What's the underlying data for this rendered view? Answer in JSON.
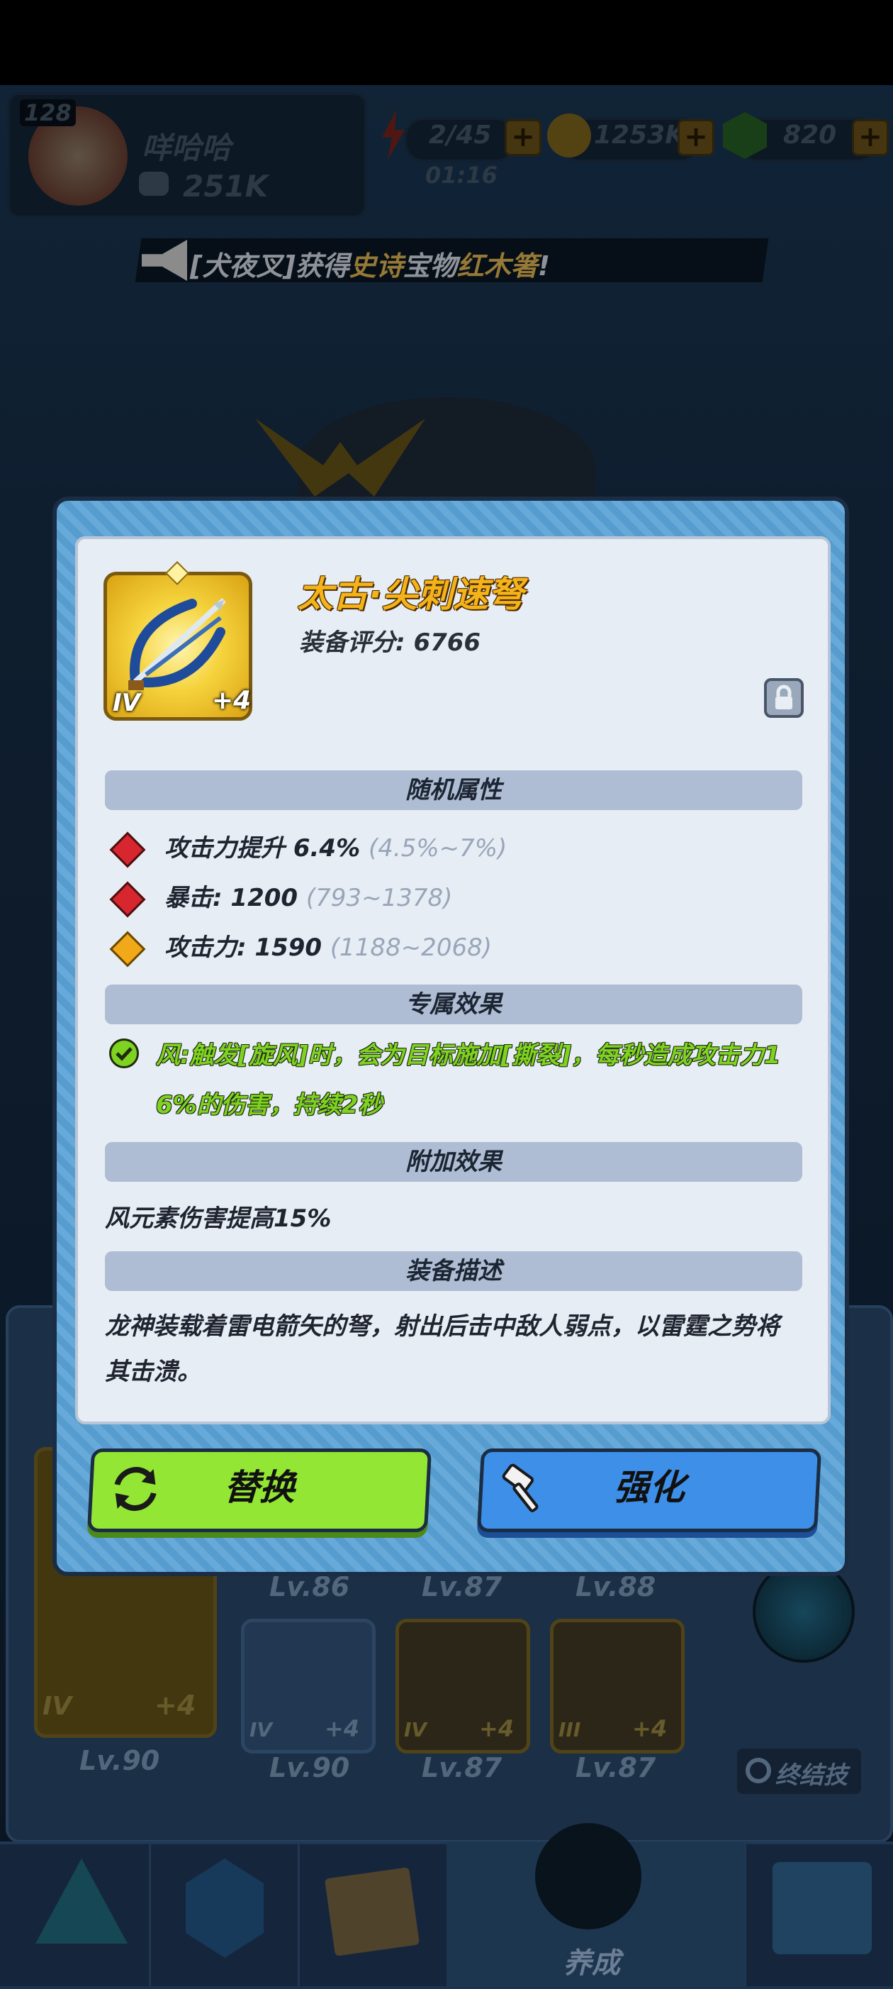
{
  "hud": {
    "level": "128",
    "player_name": "咩哈哈",
    "power": "251K",
    "energy": "2/45",
    "timer": "01:16",
    "gold": "1253K",
    "gems": "820"
  },
  "announcement": {
    "prefix": "[犬夜叉]获得",
    "rarity": "史诗",
    "middle": "宝物",
    "item": "红木箸",
    "suffix": "!"
  },
  "background": {
    "equip_levels_row1": [
      "Lv.86",
      "Lv.87",
      "Lv.88"
    ],
    "equip_levels_row2": [
      "Lv.90",
      "Lv.87",
      "Lv.87"
    ],
    "big_equip": {
      "level": "Lv.90",
      "tier": "IV",
      "plus": "+4"
    },
    "small_equips": [
      {
        "tier": "IV",
        "plus": "+4"
      },
      {
        "tier": "IV",
        "plus": "+4"
      },
      {
        "tier": "III",
        "plus": "+4"
      }
    ],
    "ultimate_label": "终结技",
    "nav_active_label": "养成"
  },
  "item": {
    "name": "太古·尖刺速弩",
    "score_label": "装备评分:",
    "score": "6766",
    "tier": "IV",
    "plus": "+4",
    "locked": true
  },
  "sections": {
    "random_title": "随机属性",
    "exclusive_title": "专属效果",
    "extra_title": "附加效果",
    "desc_title": "装备描述"
  },
  "random_attrs": [
    {
      "label": "攻击力提升 6.4%",
      "range": "(4.5%~7%)",
      "color": "#d8262f"
    },
    {
      "label": "暴击: 1200",
      "range": "(793~1378)",
      "color": "#d8262f"
    },
    {
      "label": "攻击力: 1590",
      "range": "(1188~2068)",
      "color": "#f1a91a"
    }
  ],
  "exclusive": {
    "line1": "风:触发[旋风]时，会为目标施加[撕裂]，每秒造成攻击力1",
    "line2": "6%的伤害，持续2秒",
    "color": "#7ed321"
  },
  "extra_effect": "风元素伤害提高15%",
  "description": {
    "line1": "龙神装载着雷电箭矢的弩，射出后击中敌人弱点，以雷霆之势将",
    "line2": "其击溃。"
  },
  "buttons": {
    "replace": "替换",
    "upgrade": "强化",
    "replace_color": "#93e633",
    "upgrade_color": "#3d8fe8"
  }
}
